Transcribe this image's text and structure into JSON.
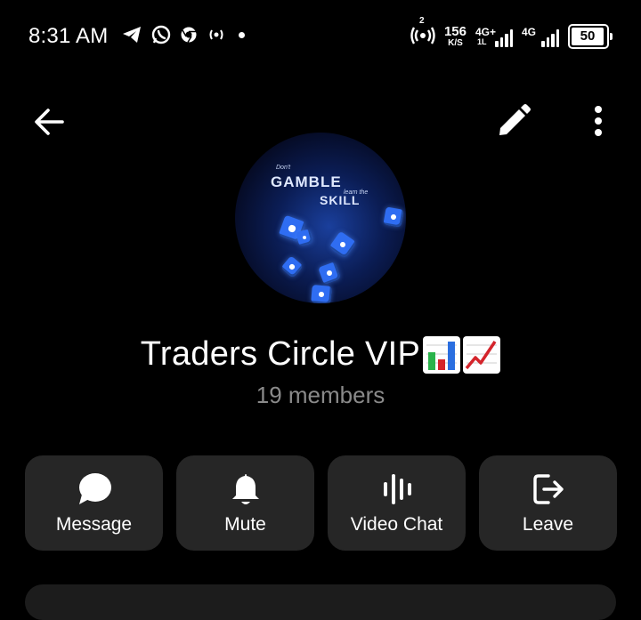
{
  "status_bar": {
    "time": "8:31 AM",
    "net_speed": "156",
    "net_speed_unit": "K/S",
    "signal1_label": "4G+",
    "signal1_sublabel": "1L",
    "signal2_label": "4G",
    "battery": "50",
    "hotspot_count": "2",
    "left_icons": [
      "telegram-icon",
      "whatsapp-icon",
      "chrome-icon",
      "hotspot-icon"
    ],
    "right_icons": [
      "hotspot-icon",
      "signal-icon",
      "signal-icon",
      "battery-icon"
    ]
  },
  "toolbar": {
    "back_icon": "arrow-left-icon",
    "edit_icon": "pencil-icon",
    "more_icon": "more-vertical-icon"
  },
  "avatar": {
    "line1": "Don't",
    "line2": "GAMBLE",
    "line3": "learn the",
    "line4": "SKILL"
  },
  "group": {
    "name": "Traders Circle VIP",
    "emojis": [
      "bar-chart-emoji",
      "chart-increasing-emoji"
    ],
    "members": "19 members"
  },
  "actions": [
    {
      "label": "Message",
      "icon": "message-bubble-icon"
    },
    {
      "label": "Mute",
      "icon": "bell-icon"
    },
    {
      "label": "Video Chat",
      "icon": "audio-waves-icon"
    },
    {
      "label": "Leave",
      "icon": "leave-icon"
    }
  ],
  "colors": {
    "background": "#000000",
    "card": "#262626",
    "muted_text": "#8a8a8a",
    "text": "#ffffff"
  }
}
